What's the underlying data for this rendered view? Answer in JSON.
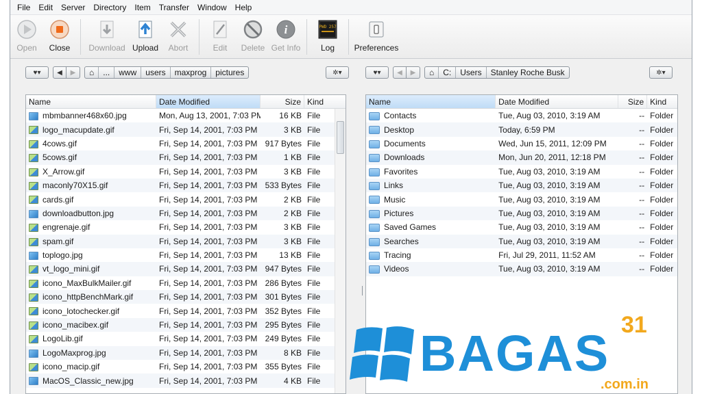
{
  "menu": [
    "File",
    "Edit",
    "Server",
    "Directory",
    "Item",
    "Transfer",
    "Window",
    "Help"
  ],
  "toolbar": {
    "open": "Open",
    "close": "Close",
    "download": "Download",
    "upload": "Upload",
    "abort": "Abort",
    "edit": "Edit",
    "delete": "Delete",
    "getinfo": "Get Info",
    "log": "Log",
    "prefs": "Preferences",
    "log_screen": "PWD 257"
  },
  "left_path": [
    "...",
    "www",
    "users",
    "maxprog",
    "pictures"
  ],
  "right_path": [
    "C:",
    "Users",
    "Stanley Roche Busk"
  ],
  "left_headers": {
    "name": "Name",
    "date": "Date Modified",
    "size": "Size",
    "kind": "Kind"
  },
  "right_headers": {
    "name": "Name",
    "date": "Date Modified",
    "size": "Size",
    "kind": "Kind"
  },
  "left_files": [
    {
      "name": "mbmbanner468x60.jpg",
      "date": "Mon, Aug 13, 2001, 7:03 PM",
      "size": "16 KB",
      "kind": "File",
      "type": "jpg"
    },
    {
      "name": "logo_macupdate.gif",
      "date": "Fri, Sep 14, 2001, 7:03 PM",
      "size": "3 KB",
      "kind": "File",
      "type": "gif"
    },
    {
      "name": "4cows.gif",
      "date": "Fri, Sep 14, 2001, 7:03 PM",
      "size": "917 Bytes",
      "kind": "File",
      "type": "gif"
    },
    {
      "name": "5cows.gif",
      "date": "Fri, Sep 14, 2001, 7:03 PM",
      "size": "1 KB",
      "kind": "File",
      "type": "gif"
    },
    {
      "name": "X_Arrow.gif",
      "date": "Fri, Sep 14, 2001, 7:03 PM",
      "size": "3 KB",
      "kind": "File",
      "type": "gif"
    },
    {
      "name": "maconly70X15.gif",
      "date": "Fri, Sep 14, 2001, 7:03 PM",
      "size": "533 Bytes",
      "kind": "File",
      "type": "gif"
    },
    {
      "name": "cards.gif",
      "date": "Fri, Sep 14, 2001, 7:03 PM",
      "size": "2 KB",
      "kind": "File",
      "type": "gif"
    },
    {
      "name": "downloadbutton.jpg",
      "date": "Fri, Sep 14, 2001, 7:03 PM",
      "size": "2 KB",
      "kind": "File",
      "type": "jpg"
    },
    {
      "name": "engrenaje.gif",
      "date": "Fri, Sep 14, 2001, 7:03 PM",
      "size": "3 KB",
      "kind": "File",
      "type": "gif"
    },
    {
      "name": "spam.gif",
      "date": "Fri, Sep 14, 2001, 7:03 PM",
      "size": "3 KB",
      "kind": "File",
      "type": "gif"
    },
    {
      "name": "toplogo.jpg",
      "date": "Fri, Sep 14, 2001, 7:03 PM",
      "size": "13 KB",
      "kind": "File",
      "type": "jpg"
    },
    {
      "name": "vt_logo_mini.gif",
      "date": "Fri, Sep 14, 2001, 7:03 PM",
      "size": "947 Bytes",
      "kind": "File",
      "type": "gif"
    },
    {
      "name": "icono_MaxBulkMailer.gif",
      "date": "Fri, Sep 14, 2001, 7:03 PM",
      "size": "286 Bytes",
      "kind": "File",
      "type": "gif"
    },
    {
      "name": "icono_httpBenchMark.gif",
      "date": "Fri, Sep 14, 2001, 7:03 PM",
      "size": "301 Bytes",
      "kind": "File",
      "type": "gif"
    },
    {
      "name": "icono_lotochecker.gif",
      "date": "Fri, Sep 14, 2001, 7:03 PM",
      "size": "352 Bytes",
      "kind": "File",
      "type": "gif"
    },
    {
      "name": "icono_macibex.gif",
      "date": "Fri, Sep 14, 2001, 7:03 PM",
      "size": "295 Bytes",
      "kind": "File",
      "type": "gif"
    },
    {
      "name": "LogoLib.gif",
      "date": "Fri, Sep 14, 2001, 7:03 PM",
      "size": "249 Bytes",
      "kind": "File",
      "type": "gif"
    },
    {
      "name": "LogoMaxprog.jpg",
      "date": "Fri, Sep 14, 2001, 7:03 PM",
      "size": "8 KB",
      "kind": "File",
      "type": "jpg"
    },
    {
      "name": "icono_macip.gif",
      "date": "Fri, Sep 14, 2001, 7:03 PM",
      "size": "355 Bytes",
      "kind": "File",
      "type": "gif"
    },
    {
      "name": "MacOS_Classic_new.jpg",
      "date": "Fri, Sep 14, 2001, 7:03 PM",
      "size": "4 KB",
      "kind": "File",
      "type": "jpg"
    }
  ],
  "right_files": [
    {
      "name": "Contacts",
      "date": "Tue, Aug 03, 2010, 3:19 AM",
      "size": "--",
      "kind": "Folder"
    },
    {
      "name": "Desktop",
      "date": "Today, 6:59 PM",
      "size": "--",
      "kind": "Folder"
    },
    {
      "name": "Documents",
      "date": "Wed, Jun 15, 2011, 12:09 PM",
      "size": "--",
      "kind": "Folder"
    },
    {
      "name": "Downloads",
      "date": "Mon, Jun 20, 2011, 12:18 PM",
      "size": "--",
      "kind": "Folder"
    },
    {
      "name": "Favorites",
      "date": "Tue, Aug 03, 2010, 3:19 AM",
      "size": "--",
      "kind": "Folder"
    },
    {
      "name": "Links",
      "date": "Tue, Aug 03, 2010, 3:19 AM",
      "size": "--",
      "kind": "Folder"
    },
    {
      "name": "Music",
      "date": "Tue, Aug 03, 2010, 3:19 AM",
      "size": "--",
      "kind": "Folder"
    },
    {
      "name": "Pictures",
      "date": "Tue, Aug 03, 2010, 3:19 AM",
      "size": "--",
      "kind": "Folder"
    },
    {
      "name": "Saved Games",
      "date": "Tue, Aug 03, 2010, 3:19 AM",
      "size": "--",
      "kind": "Folder"
    },
    {
      "name": "Searches",
      "date": "Tue, Aug 03, 2010, 3:19 AM",
      "size": "--",
      "kind": "Folder"
    },
    {
      "name": "Tracing",
      "date": "Fri, Jul 29, 2011, 11:52 AM",
      "size": "--",
      "kind": "Folder"
    },
    {
      "name": "Videos",
      "date": "Tue, Aug 03, 2010, 3:19 AM",
      "size": "--",
      "kind": "Folder"
    }
  ],
  "watermark": {
    "brand": "BAGAS",
    "number": "31",
    "domain": ".com.in"
  },
  "colors": {
    "accent": "#2a9be0",
    "selected_header": "#c7e0f7",
    "brand_blue": "#1e8fd8"
  }
}
